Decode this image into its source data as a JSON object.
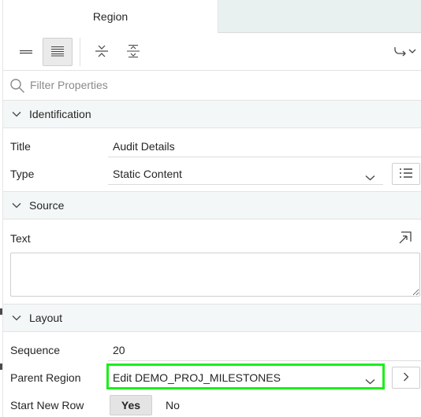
{
  "tabs": {
    "active_label": "Region"
  },
  "filter": {
    "placeholder": "Filter Properties"
  },
  "sections": {
    "identification": "Identification",
    "source": "Source",
    "layout": "Layout"
  },
  "identification": {
    "title_label": "Title",
    "title_value": "Audit Details",
    "type_label": "Type",
    "type_value": "Static Content"
  },
  "source": {
    "text_label": "Text",
    "text_value": ""
  },
  "layout": {
    "sequence_label": "Sequence",
    "sequence_value": "20",
    "parent_region_label": "Parent Region",
    "parent_region_value": "Edit DEMO_PROJ_MILESTONES",
    "start_new_row_label": "Start New Row",
    "yes_label": "Yes",
    "no_label": "No"
  },
  "colors": {
    "highlight": "#1aef1a",
    "section_bg": "#f4f7f7",
    "tab_inactive_bg": "#e8f1f0"
  },
  "icons": [
    "single-line-view-icon",
    "multi-line-view-icon",
    "collapse-all-icon",
    "expand-all-icon",
    "go-to-group-icon",
    "search-icon",
    "chevron-down-icon",
    "list-icon",
    "open-editor-icon",
    "chevron-right-icon"
  ]
}
